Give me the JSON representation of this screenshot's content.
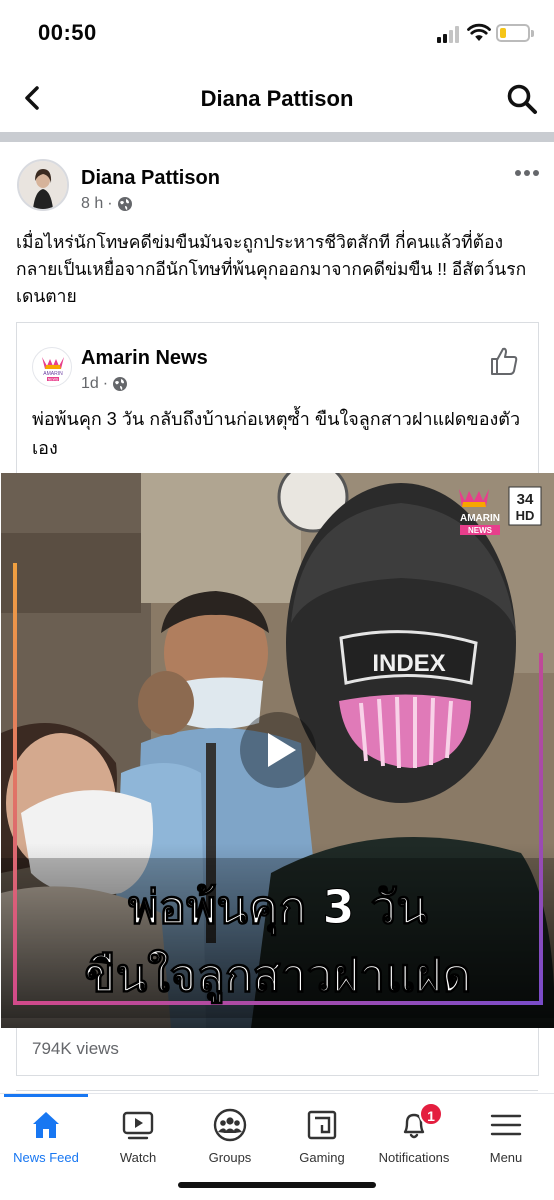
{
  "status_bar": {
    "time": "00:50",
    "battery_color": "#f5c518"
  },
  "nav": {
    "title": "Diana Pattison",
    "back_icon": "chevron-left-icon",
    "search_icon": "search-icon"
  },
  "post": {
    "author": "Diana Pattison",
    "time": "8 h",
    "separator": "·",
    "privacy_icon": "globe-icon",
    "text": "เมื่อไหร่นักโทษคดีข่มขืนมันจะถูกประหารชีวิตสักที กี่คนแล้วที่ต้องกลายเป็นเหยื่อจากอีนักโทษที่พ้นคุกออกมาจากคดีข่มขืน !! อีสัตว์นรกเดนตาย"
  },
  "shared": {
    "page_name": "Amarin News",
    "time": "1d",
    "separator": "·",
    "text": "พ่อพ้นคุก 3 วัน กลับถึงบ้านก่อเหตุซ้ำ ขืนใจลูกสาวฝาแฝดของตัวเอง",
    "logo_text": "AMARIN",
    "logo_subtext": "NEWS",
    "video": {
      "overlay_line1": "พ่อพ้นคุก 3 วัน",
      "overlay_line2": "ขืนใจลูกสาวฝาแฝด",
      "channel_text": "AMARIN",
      "channel_subtext": "NEWS",
      "channel_number": "34",
      "channel_hd": "HD",
      "helmet_text": "INDEX"
    },
    "views": "794K views"
  },
  "tabs": [
    {
      "label": "News Feed",
      "icon": "home-icon",
      "active": true
    },
    {
      "label": "Watch",
      "icon": "watch-icon",
      "active": false
    },
    {
      "label": "Groups",
      "icon": "groups-icon",
      "active": false
    },
    {
      "label": "Gaming",
      "icon": "gaming-icon",
      "active": false
    },
    {
      "label": "Notifications",
      "icon": "bell-icon",
      "active": false
    },
    {
      "label": "Menu",
      "icon": "menu-icon",
      "active": false
    }
  ],
  "notifications_badge": "1",
  "colors": {
    "accent": "#1877f2",
    "badge": "#e41e3f",
    "secondary_text": "#65676b"
  }
}
